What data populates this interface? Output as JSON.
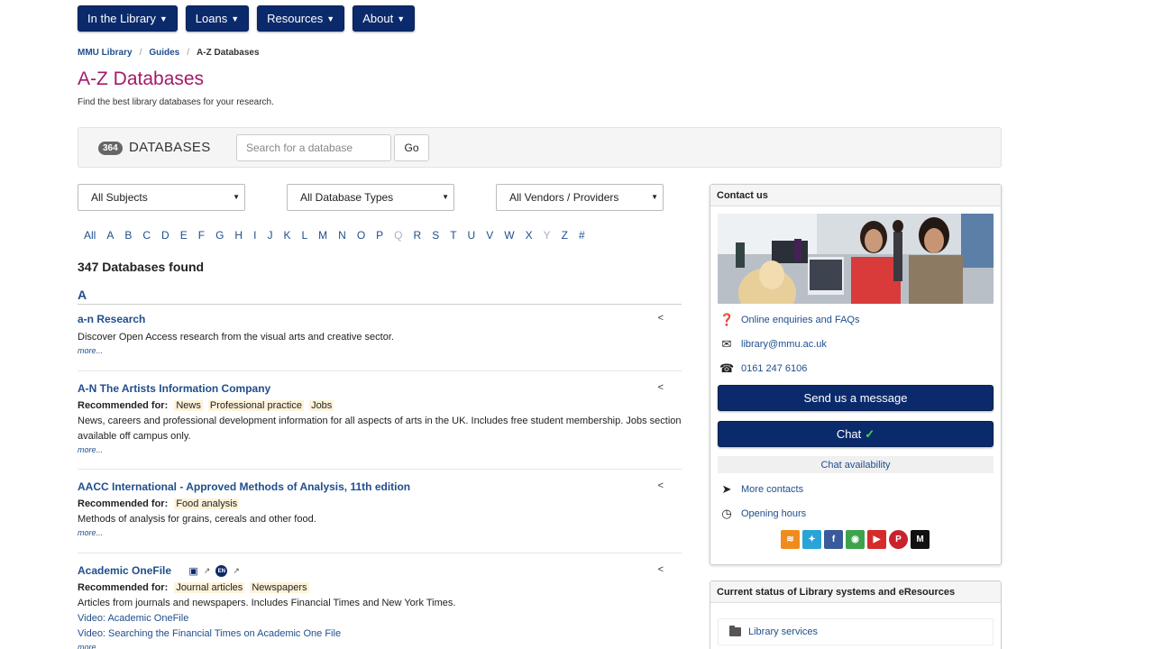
{
  "nav": [
    {
      "label": "In the Library"
    },
    {
      "label": "Loans"
    },
    {
      "label": "Resources"
    },
    {
      "label": "About"
    }
  ],
  "breadcrumb": [
    "MMU Library",
    "Guides",
    "A-Z Databases"
  ],
  "page": {
    "title": "A-Z Databases",
    "description": "Find the best library databases for your research."
  },
  "search": {
    "count": "364",
    "label": "DATABASES",
    "placeholder": "Search for a database",
    "go_label": "Go"
  },
  "filters": [
    "All Subjects",
    "All Database Types",
    "All Vendors / Providers"
  ],
  "az_letters": [
    "All",
    "A",
    "B",
    "C",
    "D",
    "E",
    "F",
    "G",
    "H",
    "I",
    "J",
    "K",
    "L",
    "M",
    "N",
    "O",
    "P",
    "Q",
    "R",
    "S",
    "T",
    "U",
    "V",
    "W",
    "X",
    "Y",
    "Z",
    "#"
  ],
  "az_disabled": [
    "Q",
    "Y"
  ],
  "results": {
    "found": "347 Databases found",
    "letter": "A"
  },
  "rec_label": "Recommended for:",
  "more_label": "more...",
  "databases": [
    {
      "title": "a-n Research",
      "description": "Discover Open Access research from the visual arts and creative sector."
    },
    {
      "title": "A-N The Artists Information Company",
      "tags": [
        "News",
        "Professional practice",
        "Jobs"
      ],
      "description": "News, careers and professional development information for all aspects of arts in the UK. Includes free student membership. Jobs section available off campus only."
    },
    {
      "title": "AACC International - Approved Methods of Analysis, 11th edition",
      "tags": [
        "Food analysis"
      ],
      "description": "Methods of analysis for grains, cereals and other food."
    },
    {
      "title": "Academic OneFile",
      "tags": [
        "Journal articles",
        "Newspapers"
      ],
      "description": "Articles from journals and newspapers. Includes Financial Times and New York Times.",
      "links": [
        "Video: Academic OneFile",
        "Video: Searching the Financial Times on Academic One File"
      ],
      "badge_en": "EN"
    }
  ],
  "contact": {
    "heading": "Contact us",
    "links": [
      "Online enquiries and FAQs",
      "library@mmu.ac.uk",
      "0161 247 6106"
    ],
    "send_label": "Send us a message",
    "chat_label": "Chat",
    "chat_check": "✓",
    "availability": "Chat availability",
    "more_links": [
      "More contacts",
      "Opening hours"
    ],
    "social_medium": "M"
  },
  "status": {
    "heading": "Current status of Library systems and eResources",
    "item": "Library services"
  }
}
